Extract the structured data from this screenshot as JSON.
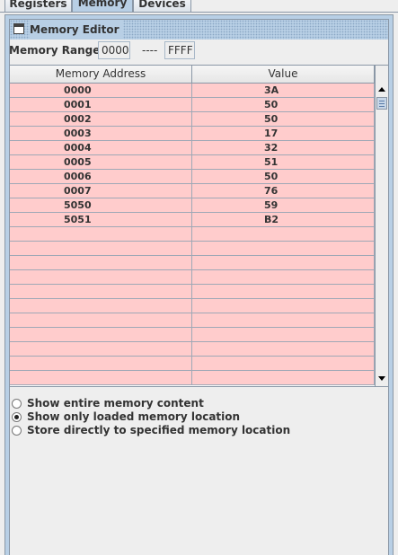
{
  "tabs": [
    {
      "label": "Registers"
    },
    {
      "label": "Memory"
    },
    {
      "label": "Devices"
    }
  ],
  "editor": {
    "title": "Memory Editor",
    "range_label": "Memory Range:",
    "range_start": "0000",
    "range_separator": "----",
    "range_end": "FFFF"
  },
  "table": {
    "columns": [
      "Memory Address",
      "Value"
    ],
    "rows": [
      {
        "address": "0000",
        "value": "3A"
      },
      {
        "address": "0001",
        "value": "50"
      },
      {
        "address": "0002",
        "value": "50"
      },
      {
        "address": "0003",
        "value": "17"
      },
      {
        "address": "0004",
        "value": "32"
      },
      {
        "address": "0005",
        "value": "51"
      },
      {
        "address": "0006",
        "value": "50"
      },
      {
        "address": "0007",
        "value": "76"
      },
      {
        "address": "5050",
        "value": "59"
      },
      {
        "address": "5051",
        "value": "B2"
      },
      {
        "address": "",
        "value": ""
      },
      {
        "address": "",
        "value": ""
      },
      {
        "address": "",
        "value": ""
      },
      {
        "address": "",
        "value": ""
      },
      {
        "address": "",
        "value": ""
      },
      {
        "address": "",
        "value": ""
      },
      {
        "address": "",
        "value": ""
      },
      {
        "address": "",
        "value": ""
      },
      {
        "address": "",
        "value": ""
      },
      {
        "address": "",
        "value": ""
      },
      {
        "address": "",
        "value": ""
      }
    ],
    "row_color": "#ffcccc"
  },
  "options": [
    {
      "label": "Show entire memory content",
      "checked": false
    },
    {
      "label": "Show only loaded memory location",
      "checked": true
    },
    {
      "label": "Store directly to specified memory location",
      "checked": false
    }
  ],
  "colors": {
    "accent": "#b8cfe5",
    "background": "#eeeeee",
    "border": "#8a97a6"
  },
  "icons": {
    "window": "window-icon",
    "scroll_up": "arrow-up-icon",
    "scroll_down": "arrow-down-icon"
  }
}
